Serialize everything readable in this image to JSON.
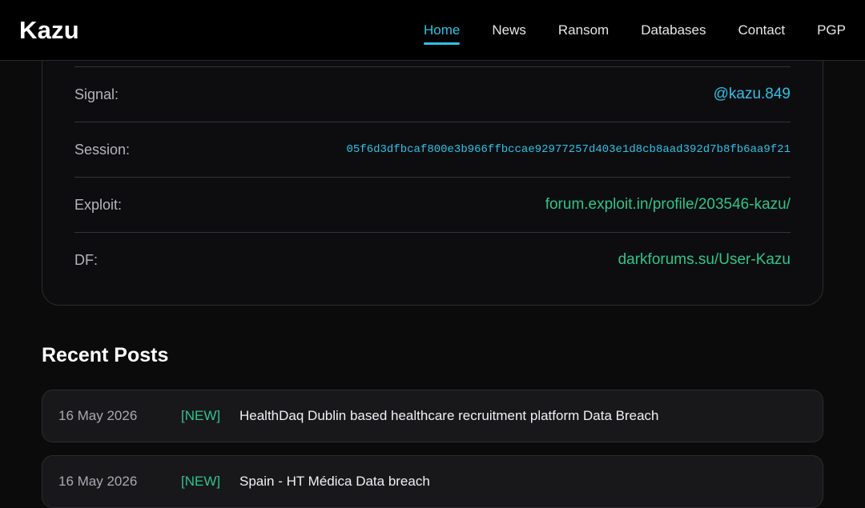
{
  "header": {
    "brand": "Kazu",
    "nav": [
      {
        "label": "Home",
        "active": true
      },
      {
        "label": "News"
      },
      {
        "label": "Ransom"
      },
      {
        "label": "Databases"
      },
      {
        "label": "Contact"
      },
      {
        "label": "PGP"
      }
    ]
  },
  "contacts": [
    {
      "label": "Signal:",
      "value": "@kazu.849"
    },
    {
      "label": "Session:",
      "value": "05f6d3dfbcaf800e3b966ffbccae92977257d403e1d8cb8aad392d7b8fb6aa9f21"
    },
    {
      "label": "Exploit:",
      "value": "forum.exploit.in/profile/203546-kazu/"
    },
    {
      "label": "DF:",
      "value": "darkforums.su/User-Kazu"
    }
  ],
  "recent_posts": {
    "title": "Recent Posts",
    "items": [
      {
        "date": "16 May 2026",
        "tag": "[NEW]",
        "title": "HealthDaq Dublin based healthcare recruitment platform Data Breach"
      },
      {
        "date": "16 May 2026",
        "tag": "[NEW]",
        "title": "Spain - HT Médica Data breach"
      }
    ]
  },
  "colors": {
    "accent": "#2ec1e6",
    "green": "#2fc48a",
    "background": "#0b0b0c"
  }
}
